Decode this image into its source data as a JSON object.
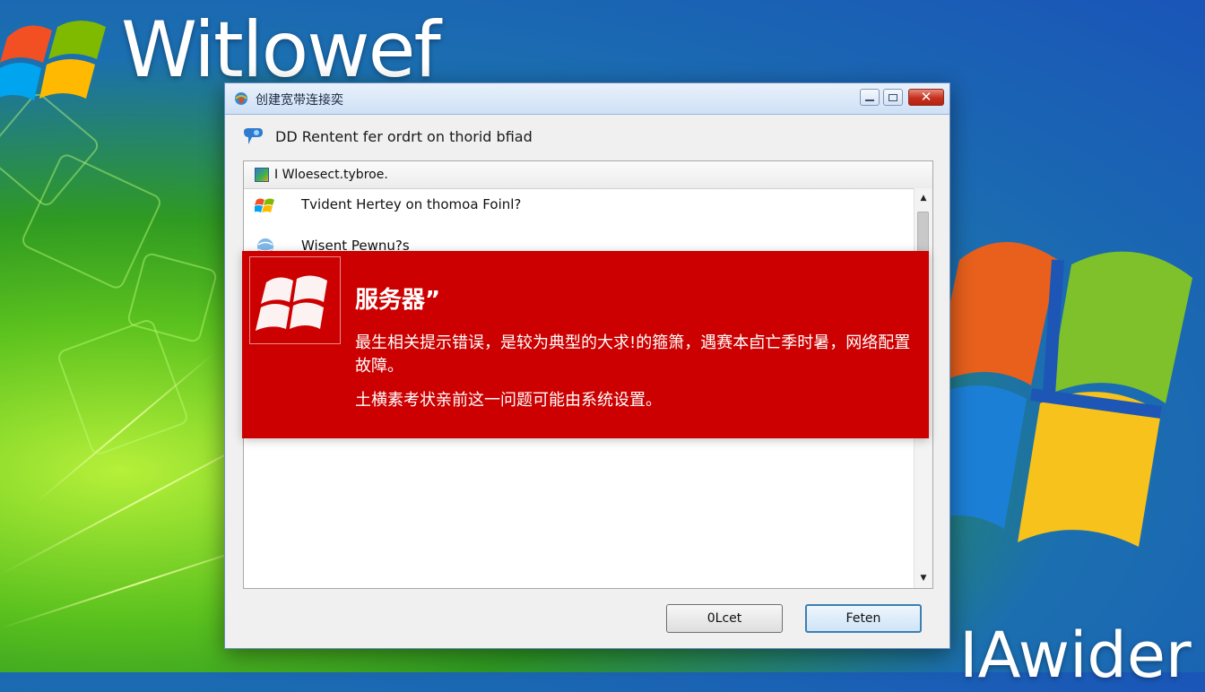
{
  "desktop": {
    "brand_top": "Witlowef",
    "brand_bottom": "IAwider",
    "logo_icon": "windows-flag-icon"
  },
  "dialog": {
    "title": "创建宽带连接奕",
    "heading": "DD Rentent fer ordrt on thorid bfiad",
    "list_header": "I Wloesect.tybroe.",
    "items": [
      {
        "label": "Tvident Hertey on thomoa Foinl?",
        "icon": "windows-flag-icon"
      },
      {
        "label": "Wisent Pewnu?s",
        "icon": "network-globe-icon"
      }
    ],
    "buttons": {
      "ok": "0Lcet",
      "primary": "Feten"
    }
  },
  "error_banner": {
    "title": "服务器”",
    "body": "最生相关提示错误，是较为典型的大求!的箍箫，遇赛本卣亡季时暑，网络配置故障。",
    "body2": "土横素考状亲前这一问题可能由系统设置。",
    "background_color": "#cc0000"
  }
}
